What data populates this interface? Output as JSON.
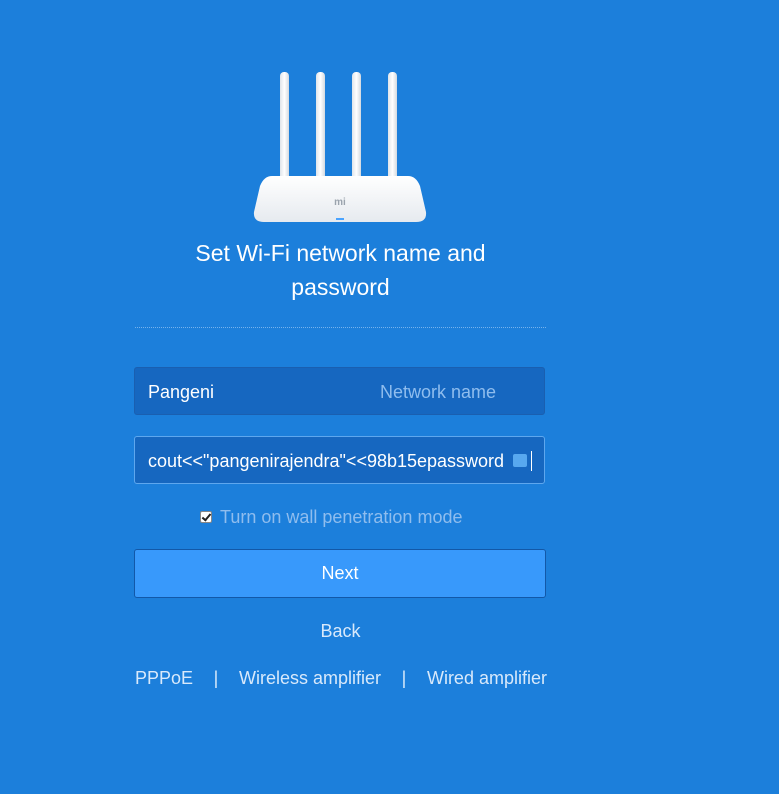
{
  "router": {
    "brand_mark": "mi"
  },
  "title": {
    "line1": "Set Wi-Fi network name and",
    "line2": "password"
  },
  "network_name": {
    "value": "Pangeni",
    "placeholder": "Network name"
  },
  "password": {
    "value": "cout<<\"pangenirajendra\"<<98b15epassword"
  },
  "wall_penetration": {
    "checked": true,
    "label": "Turn on wall penetration mode"
  },
  "buttons": {
    "next": "Next",
    "back": "Back"
  },
  "bottom_links": {
    "pppoe": "PPPoE",
    "separator": "|",
    "wireless_amplifier": "Wireless amplifier",
    "wired_amplifier": "Wired amplifier"
  },
  "colors": {
    "background": "#1c7fdb",
    "field": "#1667c0",
    "button": "#3899fb"
  }
}
